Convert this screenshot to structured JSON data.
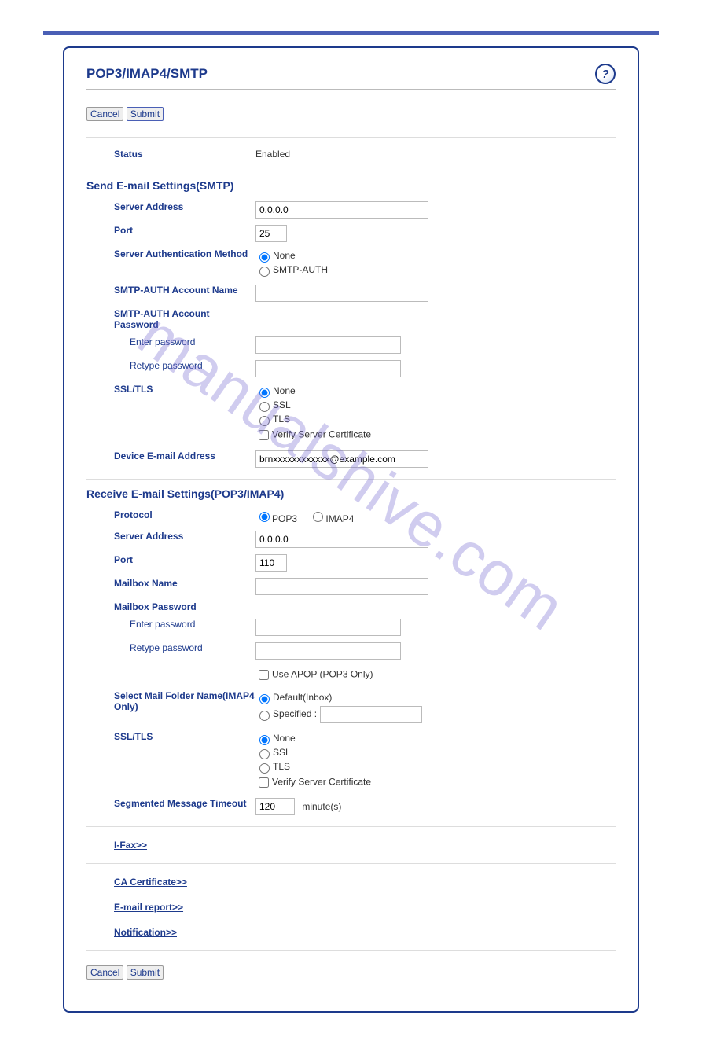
{
  "watermark": "manualshive.com",
  "page_title": "POP3/IMAP4/SMTP",
  "buttons": {
    "cancel": "Cancel",
    "submit": "Submit"
  },
  "status": {
    "label": "Status",
    "value": "Enabled"
  },
  "smtp": {
    "heading": "Send E-mail Settings(SMTP)",
    "server_address": {
      "label": "Server Address",
      "value": "0.0.0.0"
    },
    "port": {
      "label": "Port",
      "value": "25"
    },
    "auth_method": {
      "label": "Server Authentication Method",
      "none": "None",
      "smtp_auth": "SMTP-AUTH"
    },
    "auth_account_name": {
      "label": "SMTP-AUTH Account Name",
      "value": ""
    },
    "auth_password": {
      "label": "SMTP-AUTH Account Password",
      "enter": "Enter password",
      "retype": "Retype password"
    },
    "ssl_tls": {
      "label": "SSL/TLS",
      "none": "None",
      "ssl": "SSL",
      "tls": "TLS",
      "verify": "Verify Server Certificate"
    },
    "device_email": {
      "label": "Device E-mail Address",
      "value": "brnxxxxxxxxxxxx@example.com"
    }
  },
  "pop": {
    "heading": "Receive E-mail Settings(POP3/IMAP4)",
    "protocol": {
      "label": "Protocol",
      "pop3": "POP3",
      "imap4": "IMAP4"
    },
    "server_address": {
      "label": "Server Address",
      "value": "0.0.0.0"
    },
    "port": {
      "label": "Port",
      "value": "110"
    },
    "mailbox_name": {
      "label": "Mailbox Name",
      "value": ""
    },
    "mailbox_password": {
      "label": "Mailbox Password",
      "enter": "Enter password",
      "retype": "Retype password"
    },
    "apop": "Use APOP (POP3 Only)",
    "folder": {
      "label": "Select Mail Folder Name(IMAP4 Only)",
      "default": "Default(Inbox)",
      "specified": "Specified :"
    },
    "ssl_tls": {
      "label": "SSL/TLS",
      "none": "None",
      "ssl": "SSL",
      "tls": "TLS",
      "verify": "Verify Server Certificate"
    },
    "seg_timeout": {
      "label": "Segmented Message Timeout",
      "value": "120",
      "unit": "minute(s)"
    }
  },
  "links": {
    "ifax": "I-Fax>>",
    "ca_cert": "CA Certificate>>",
    "email_report": "E-mail report>>",
    "notification": "Notification>>"
  }
}
